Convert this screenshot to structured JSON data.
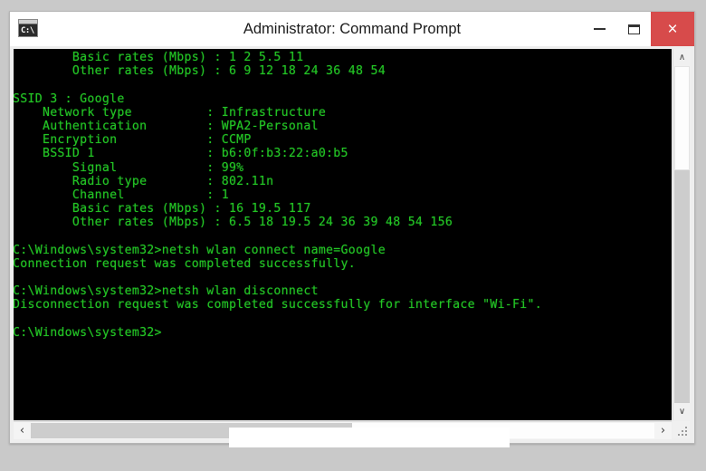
{
  "window": {
    "title": "Administrator: Command Prompt",
    "app_icon": "console-icon",
    "app_icon_text": "C:\\",
    "controls": {
      "minimize": "minimize-button",
      "maximize": "maximize-button",
      "close": "×"
    },
    "colors": {
      "close_button": "#d74b4b",
      "terminal_background": "#000000",
      "terminal_text": "#23c423",
      "titlebar_background": "#ffffff",
      "page_background": "#c9c9c9"
    }
  },
  "scrollbars": {
    "vertical": {
      "up_arrow": "∧",
      "down_arrow": "∨"
    },
    "horizontal": {
      "left_arrow": "‹",
      "right_arrow": "›"
    },
    "resize_grip": "resize-grip"
  },
  "terminal": {
    "lines": [
      "        Basic rates (Mbps) : 1 2 5.5 11",
      "        Other rates (Mbps) : 6 9 12 18 24 36 48 54",
      "",
      "SSID 3 : Google",
      "    Network type          : Infrastructure",
      "    Authentication        : WPA2-Personal",
      "    Encryption            : CCMP",
      "    BSSID 1               : b6:0f:b3:22:a0:b5",
      "        Signal            : 99%",
      "        Radio type        : 802.11n",
      "        Channel           : 1",
      "        Basic rates (Mbps) : 16 19.5 117",
      "        Other rates (Mbps) : 6.5 18 19.5 24 36 39 48 54 156",
      "",
      "C:\\Windows\\system32>netsh wlan connect name=Google",
      "Connection request was completed successfully.",
      "",
      "C:\\Windows\\system32>netsh wlan disconnect",
      "Disconnection request was completed successfully for interface \"Wi-Fi\".",
      "",
      "C:\\Windows\\system32>"
    ]
  }
}
